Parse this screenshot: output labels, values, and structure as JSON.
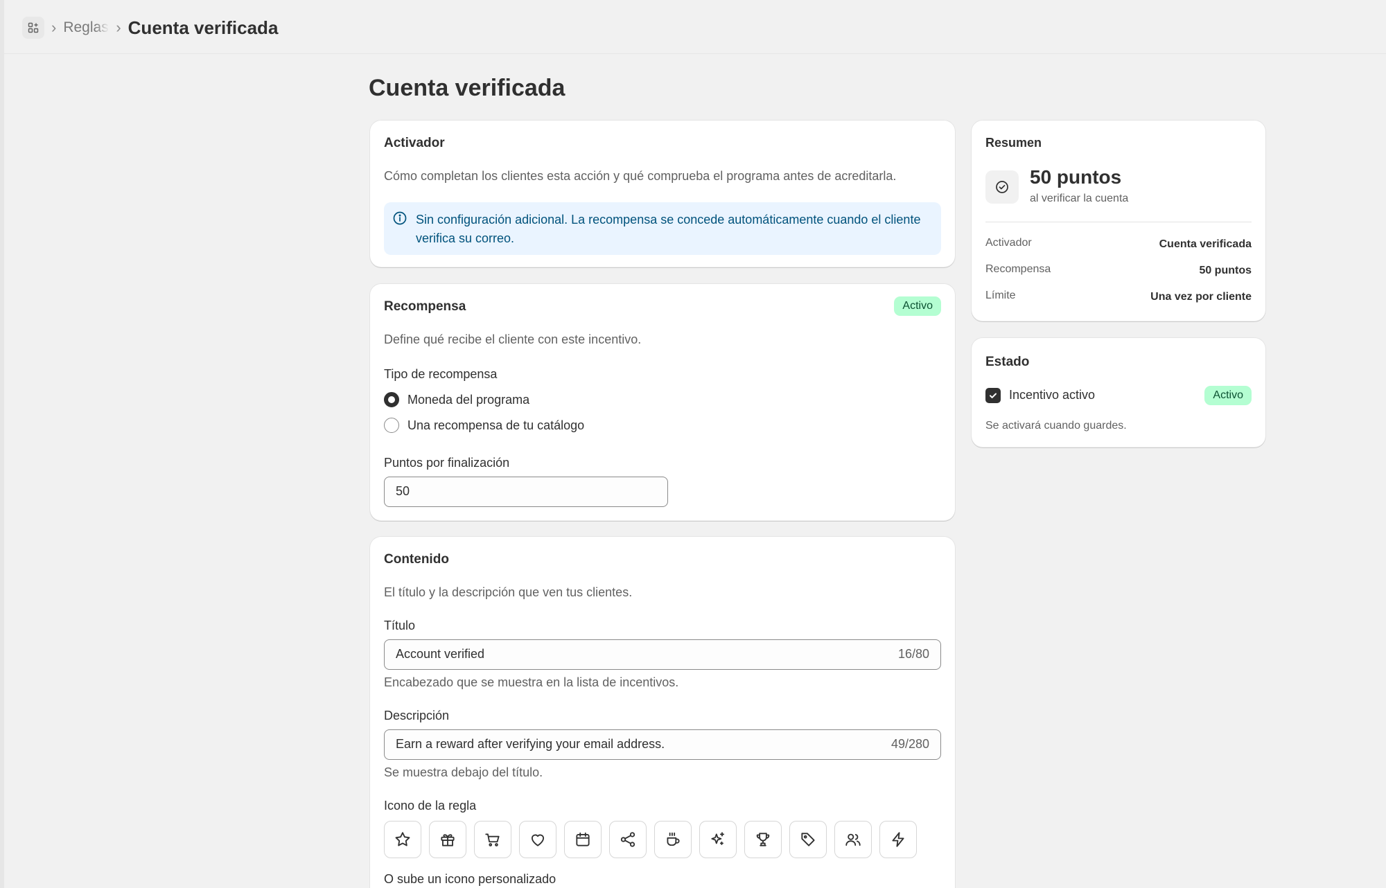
{
  "breadcrumb": {
    "home_icon": "apps-icon",
    "parent": "Reglas de incentivos",
    "current": "Cuenta verificada"
  },
  "page": {
    "title": "Cuenta verificada"
  },
  "trigger_card": {
    "title": "Activador",
    "description": "Cómo completan los clientes esta acción y qué comprueba el programa antes de acreditarla.",
    "banner_icon": "info-icon",
    "banner_text": "Sin configuración adicional. La recompensa se concede automáticamente cuando el cliente verifica su correo."
  },
  "reward_card": {
    "title": "Recompensa",
    "badge": "Activo",
    "description": "Define qué recibe el cliente con este incentivo.",
    "type_label": "Tipo de recompensa",
    "options": [
      {
        "label": "Moneda del programa",
        "selected": true
      },
      {
        "label": "Una recompensa de tu catálogo",
        "selected": false
      }
    ],
    "points_label": "Puntos por finalización",
    "points_value": "50"
  },
  "content_card": {
    "title": "Contenido",
    "description": "El título y la descripción que ven tus clientes.",
    "title_label": "Título",
    "title_value": "Account verified",
    "title_count": "16/80",
    "title_help": "Encabezado que se muestra en la lista de incentivos.",
    "desc_label": "Descripción",
    "desc_value": "Earn a reward after verifying your email address.",
    "desc_count": "49/280",
    "desc_help": "Se muestra debajo del título.",
    "icon_label": "Icono de la regla",
    "icons": [
      "star-icon",
      "gift-icon",
      "cart-icon",
      "heart-icon",
      "calendar-icon",
      "share-icon",
      "coffee-icon",
      "sparkles-icon",
      "trophy-icon",
      "tag-icon",
      "users-icon",
      "bolt-icon"
    ],
    "upload_label": "O sube un icono personalizado"
  },
  "summary_card": {
    "title": "Resumen",
    "icon": "check-circle-icon",
    "points": "50 puntos",
    "subtitle": "al verificar la cuenta",
    "rows": [
      {
        "key": "Activador",
        "value": "Cuenta verificada"
      },
      {
        "key": "Recompensa",
        "value": "50 puntos"
      },
      {
        "key": "Límite",
        "value": "Una vez por cliente"
      }
    ]
  },
  "status_card": {
    "title": "Estado",
    "checkbox_label": "Incentivo activo",
    "checked": true,
    "badge": "Activo",
    "note": "Se activará cuando guardes."
  }
}
